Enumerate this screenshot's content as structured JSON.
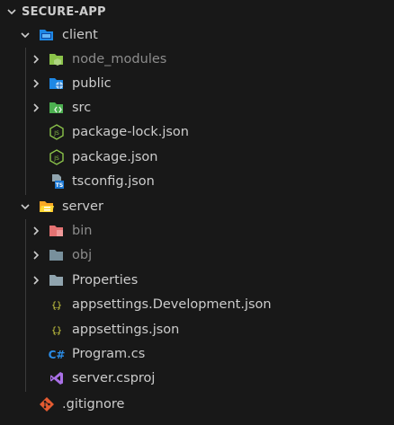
{
  "explorer": {
    "root": "SECURE-APP",
    "client": {
      "label": "client",
      "children": [
        "node_modules",
        "public",
        "src",
        "package-lock.json",
        "package.json",
        "tsconfig.json"
      ]
    },
    "server": {
      "label": "server",
      "children": [
        "bin",
        "obj",
        "Properties",
        "appsettings.Development.json",
        "appsettings.json",
        "Program.cs",
        "server.csproj"
      ]
    },
    "root_files": [
      ".gitignore"
    ]
  },
  "colors": {
    "background": "#181818",
    "text": "#cccccc",
    "dim_text": "#8c8c8c",
    "json_icon": "#cbcb41",
    "node_icon": "#8bc34a",
    "csharp_icon": "#2b8ce6",
    "csproj_icon": "#a970e6",
    "git_icon": "#e45b31"
  }
}
